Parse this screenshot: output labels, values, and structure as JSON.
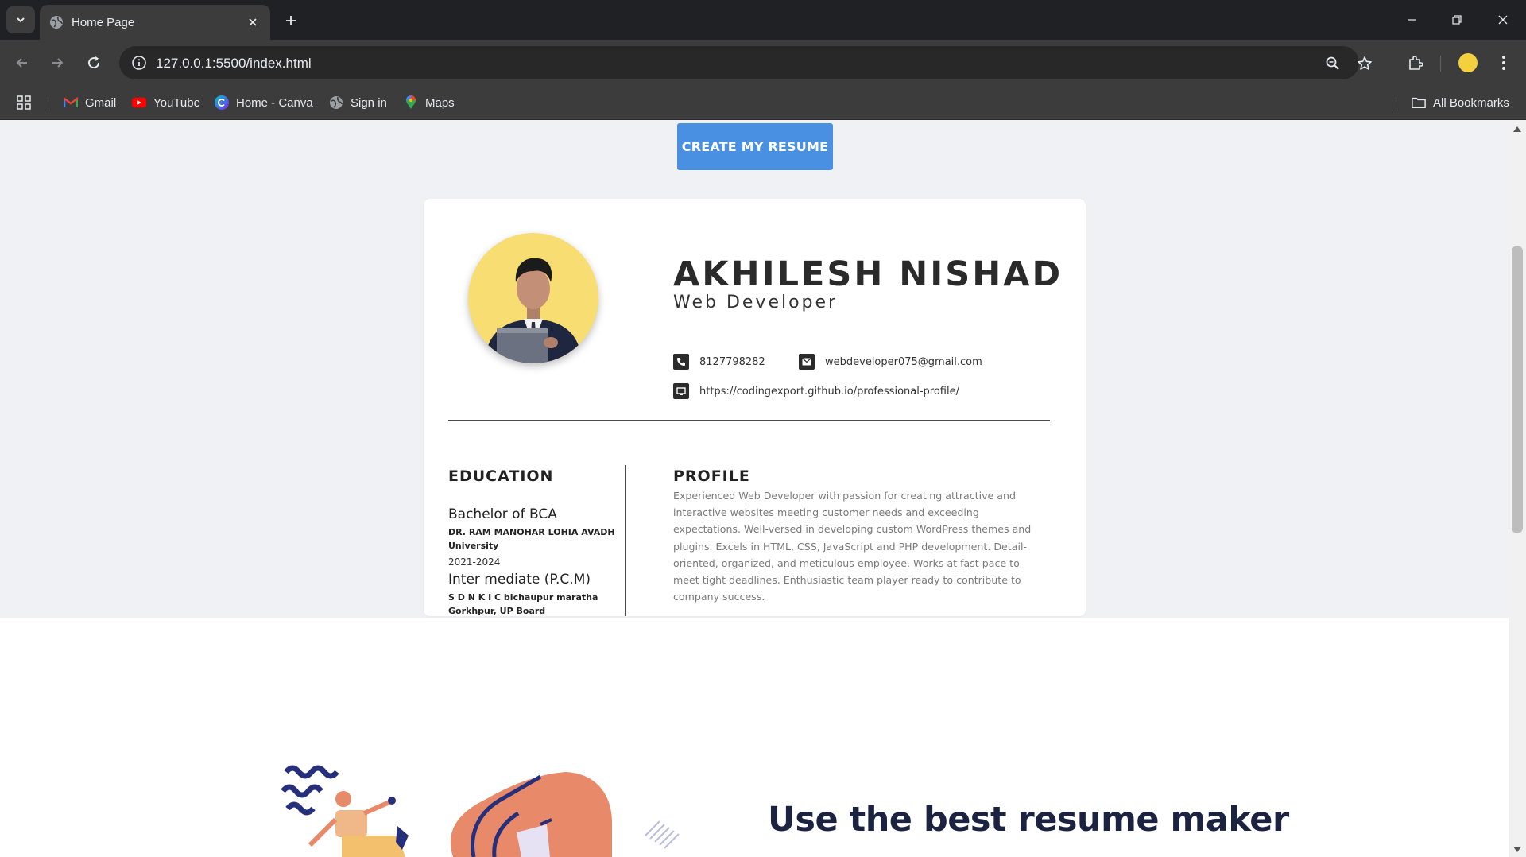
{
  "browser": {
    "tab_title": "Home Page",
    "url": "127.0.0.1:5500/index.html",
    "bookmarks": [
      {
        "label": "Gmail",
        "icon": "gmail-icon"
      },
      {
        "label": "YouTube",
        "icon": "youtube-icon"
      },
      {
        "label": "Home - Canva",
        "icon": "canva-icon"
      },
      {
        "label": "Sign in",
        "icon": "globe-icon"
      },
      {
        "label": "Maps",
        "icon": "maps-icon"
      }
    ],
    "all_bookmarks": "All Bookmarks"
  },
  "page": {
    "create_button": "CREATE MY RESUME",
    "accent_color": "#4a90e2",
    "resume": {
      "name": "AKHILESH NISHAD",
      "role": "Web Developer",
      "phone": "8127798282",
      "email": "webdeveloper075@gmail.com",
      "website": "https://codingexport.github.io/professional-profile/",
      "education_title": "EDUCATION",
      "education": [
        {
          "degree": "Bachelor of BCA",
          "institution": "DR. RAM MANOHAR LOHIA AVADH University",
          "years": "2021-2024"
        },
        {
          "degree": "Inter mediate (P.C.M)",
          "institution": "S D N K I C bichaupur maratha Gorkhpur, UP Board"
        }
      ],
      "profile_title": "PROFILE",
      "profile_text": "Experienced Web Developer with passion for creating attractive and interactive websites meeting customer needs and exceeding expectations. Well-versed in developing custom WordPress themes and plugins. Excels in HTML, CSS, JavaScript and PHP development. Detail-oriented, organized, and meticulous employee. Works at fast pace to meet tight deadlines. Enthusiastic team player ready to contribute to company success."
    },
    "hero_title": "Use the best resume maker"
  }
}
